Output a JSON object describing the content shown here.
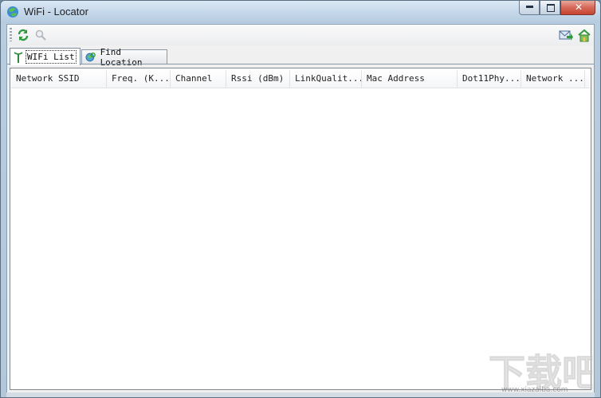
{
  "window": {
    "title": "WiFi - Locator"
  },
  "toolbar": {
    "buttons": [
      {
        "name": "refresh",
        "icon": "refresh-icon"
      },
      {
        "name": "search",
        "icon": "magnifier-icon"
      },
      {
        "name": "send-email",
        "icon": "mail-arrow-icon"
      },
      {
        "name": "home",
        "icon": "home-icon"
      }
    ]
  },
  "tabs": [
    {
      "label": "WIFi List",
      "icon": "antenna-icon",
      "active": true
    },
    {
      "label": "Find Location",
      "icon": "globe-search-icon",
      "active": false
    }
  ],
  "list": {
    "columns": [
      "Network SSID",
      "Freq. (K...",
      "Channel",
      "Rssi (dBm)",
      "LinkQualit...",
      "Mac Address",
      "Dot11Phy...",
      "Network ..."
    ],
    "rows": []
  },
  "watermark": {
    "text": "下载吧",
    "url": "www.xiazaiba.com"
  },
  "colors": {
    "accent_green": "#3a9a3a",
    "close_red": "#c64530",
    "titlebar": "#c5d8ea"
  }
}
